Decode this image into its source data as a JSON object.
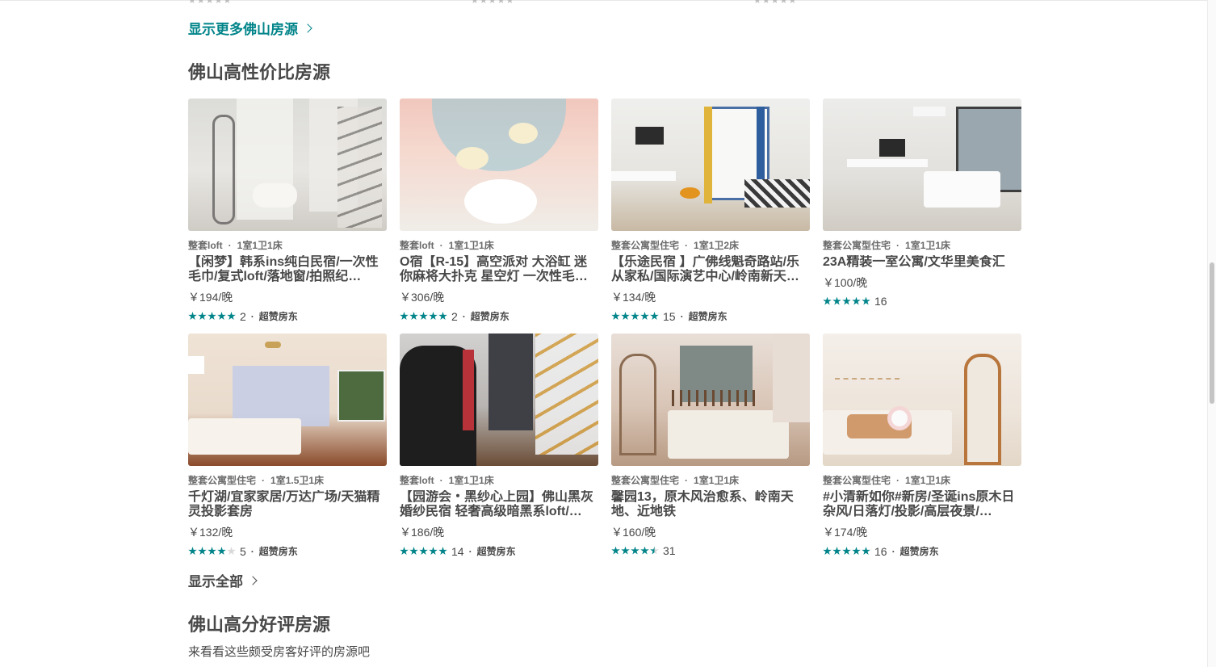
{
  "top_link": {
    "label": "显示更多佛山房源"
  },
  "section1": {
    "title": "佛山高性价比房源",
    "show_all": "显示全部"
  },
  "section2": {
    "title": "佛山高分好评房源",
    "subtitle": "来看看这些颇受房客好评的房源吧"
  },
  "colors": {
    "accent": "#008489",
    "text": "#484848",
    "meta": "#6b6b6b"
  },
  "listings": [
    {
      "type": "整套loft",
      "rooms": "1室1卫1床",
      "title": "【闲梦】韩系ins纯白民宿/一次性毛巾/复式loft/落地窗/拍照纪…",
      "price": "￥194/晚",
      "rating": 5,
      "reviews": "2",
      "badge": "超赞房东"
    },
    {
      "type": "整套loft",
      "rooms": "1室1卫1床",
      "title": "O宿【R-15】高空派对 大浴缸 迷你麻将大扑克 星空灯 一次性毛…",
      "price": "￥306/晚",
      "rating": 5,
      "reviews": "2",
      "badge": "超赞房东"
    },
    {
      "type": "整套公寓型住宅",
      "rooms": "1室1卫2床",
      "title": "【乐途民宿 】广佛线魁奇路站/乐从家私/国际演艺中心/岭南新天…",
      "price": "￥134/晚",
      "rating": 5,
      "reviews": "15",
      "badge": "超赞房东"
    },
    {
      "type": "整套公寓型住宅",
      "rooms": "1室1卫1床",
      "title": "23A精装一室公寓/文华里美食汇",
      "price": "￥100/晚",
      "rating": 5,
      "reviews": "16",
      "badge": ""
    },
    {
      "type": "整套公寓型住宅",
      "rooms": "1室1.5卫1床",
      "title": "千灯湖/宜家家居/万达广场/天猫精灵投影套房",
      "price": "￥132/晚",
      "rating": 4,
      "reviews": "5",
      "badge": "超赞房东"
    },
    {
      "type": "整套loft",
      "rooms": "1室1卫1床",
      "title": "【园游会・黑纱心上园】佛山黑灰婚纱民宿 轻奢高级暗黑系loft/…",
      "price": "￥186/晚",
      "rating": 5,
      "reviews": "14",
      "badge": "超赞房东"
    },
    {
      "type": "整套公寓型住宅",
      "rooms": "1室1卫1床",
      "title": "馨园13，原木风治愈系、岭南天地、近地铁",
      "price": "￥160/晚",
      "rating": 4.5,
      "reviews": "31",
      "badge": ""
    },
    {
      "type": "整套公寓型住宅",
      "rooms": "1室1卫1床",
      "title": "#小清新如你#新房/圣诞ins原木日杂风/日落灯/投影/高层夜景/…",
      "price": "￥174/晚",
      "rating": 5,
      "reviews": "16",
      "badge": "超赞房东"
    }
  ]
}
